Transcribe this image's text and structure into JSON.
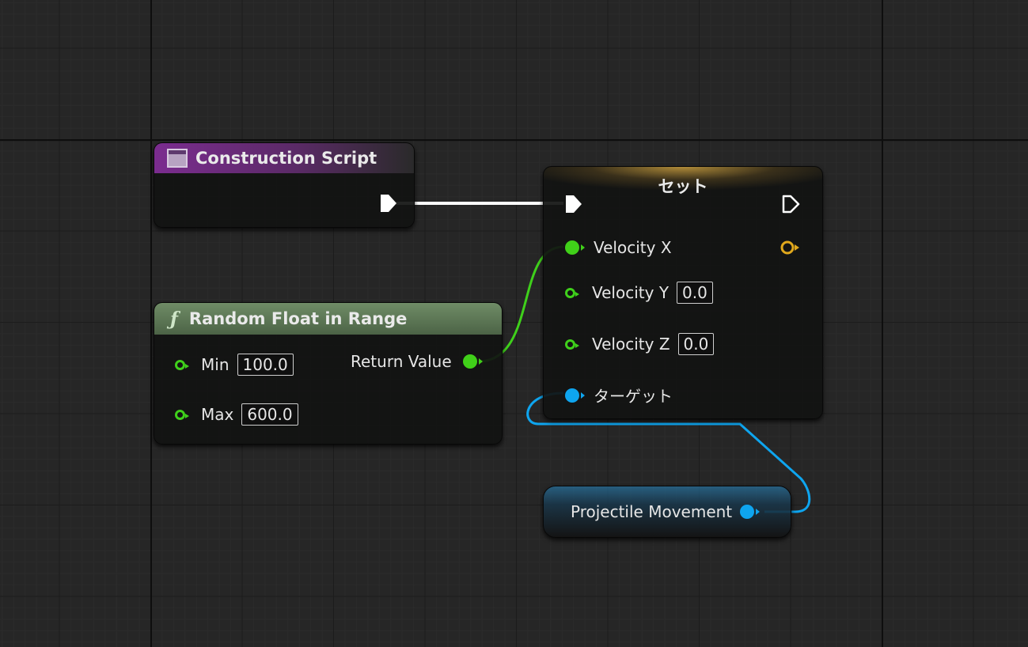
{
  "nodes": {
    "construction_script": {
      "title": "Construction Script",
      "header_color": "#7b2c8f"
    },
    "random_float": {
      "title": "Random Float in Range",
      "func_glyph": "ƒ",
      "header_color": "#5f7a58",
      "inputs": [
        {
          "label": "Min",
          "value": "100.0"
        },
        {
          "label": "Max",
          "value": "600.0"
        }
      ],
      "output": {
        "label": "Return Value"
      }
    },
    "set": {
      "title": "セット",
      "header_color": "#c9a23c",
      "inputs": [
        {
          "label": "Velocity X"
        },
        {
          "label": "Velocity Y",
          "value": "0.0"
        },
        {
          "label": "Velocity Z",
          "value": "0.0"
        },
        {
          "label": "ターゲット"
        }
      ]
    },
    "projectile": {
      "label": "Projectile Movement",
      "header_color": "#1e7fb0"
    }
  },
  "colors": {
    "float_pin": "#3fd01b",
    "object_pin": "#0ea5ef",
    "struct_pin": "#e0a81c",
    "exec_wire": "#ffffff"
  }
}
